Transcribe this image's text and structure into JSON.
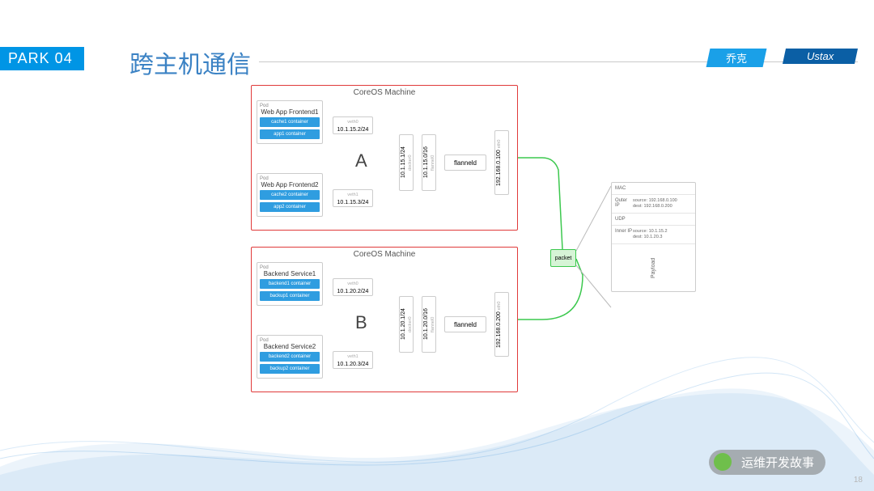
{
  "header": {
    "park": "PARK 04",
    "title": "跨主机通信",
    "tag1": "乔克",
    "tag2": "Ustax"
  },
  "machine_label": "CoreOS Machine",
  "machines": {
    "A": {
      "letter": "A",
      "pods": [
        {
          "kind": "Pod",
          "name": "Web App Frontend1",
          "containers": [
            "cache1 container",
            "app1 container"
          ]
        },
        {
          "kind": "Pod",
          "name": "Web App Frontend2",
          "containers": [
            "cache2 container",
            "app2 container"
          ]
        }
      ],
      "veth": [
        {
          "sub": "veth0",
          "ip": "10.1.15.2/24"
        },
        {
          "sub": "veth1",
          "ip": "10.1.15.3/24"
        }
      ],
      "docker0": {
        "sub": "docker0",
        "ip": "10.1.15.1/24"
      },
      "flannel0": {
        "sub": "flannel0",
        "ip": "10.1.15.0/16"
      },
      "flanneld": "flanneld",
      "eth": {
        "sub": "eth0",
        "ip": "192.168.0.100"
      }
    },
    "B": {
      "letter": "B",
      "pods": [
        {
          "kind": "Pod",
          "name": "Backend Service1",
          "containers": [
            "backend1 container",
            "backup1 container"
          ]
        },
        {
          "kind": "Pod",
          "name": "Backend Service2",
          "containers": [
            "backend2 container",
            "backup2 container"
          ]
        }
      ],
      "veth": [
        {
          "sub": "veth0",
          "ip": "10.1.20.2/24"
        },
        {
          "sub": "veth1",
          "ip": "10.1.20.3/24"
        }
      ],
      "docker0": {
        "sub": "docker0",
        "ip": "10.1.20.1/24"
      },
      "flannel0": {
        "sub": "flannel0",
        "ip": "10.1.20.0/16"
      },
      "flanneld": "flanneld",
      "eth": {
        "sub": "eth0",
        "ip": "192.168.0.200"
      }
    }
  },
  "packet_label": "packet",
  "packet_detail": {
    "mac": "MAC",
    "outer_ip_label": "Outer IP",
    "outer_ip": "source: 192.168.0.100\ndest: 192.168.0.200",
    "udp": "UDP",
    "inner_ip_label": "Inner IP",
    "inner_ip": "source: 10.1.15.2\ndest: 10.1.20.3",
    "payload": "Payload"
  },
  "watermark": "运维开发故事",
  "page": "18"
}
